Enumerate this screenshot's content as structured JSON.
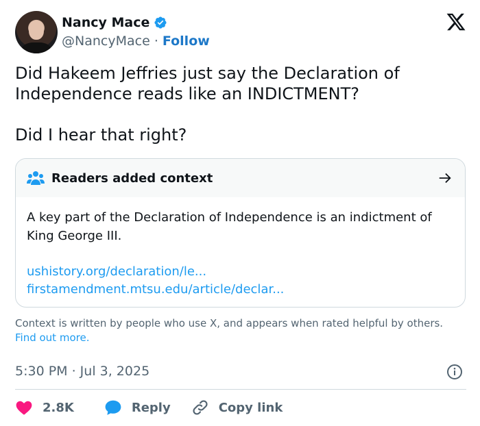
{
  "author": {
    "display_name": "Nancy Mace",
    "handle": "@NancyMace",
    "separator": "·",
    "follow_label": "Follow",
    "verified_icon": "verified-badge-icon",
    "verified_color": "#1d9bf0"
  },
  "brand": {
    "logo_icon": "x-logo-icon"
  },
  "tweet": {
    "paragraphs": [
      "Did Hakeem Jeffries just say the Declaration of Independence reads like an INDICTMENT?",
      "Did I hear that right?"
    ]
  },
  "context_card": {
    "title": "Readers added context",
    "icon": "readers-icon",
    "body": "A key part of the Declaration of Independence is an indictment of King George III.",
    "links": [
      "ushistory.org/declaration/le...",
      "firstamendment.mtsu.edu/article/declar..."
    ]
  },
  "disclaimer": {
    "text": "Context is written by people who use X, and appears when rated helpful by others.",
    "link": "Find out more."
  },
  "meta": {
    "timestamp": "5:30 PM · Jul 3, 2025"
  },
  "actions": {
    "like_count": "2.8K",
    "reply_label": "Reply",
    "copy_link_label": "Copy link"
  },
  "colors": {
    "like": "#f91880",
    "reply": "#1d9bf0",
    "link": "#1d9bf0",
    "text_secondary": "#536471"
  }
}
